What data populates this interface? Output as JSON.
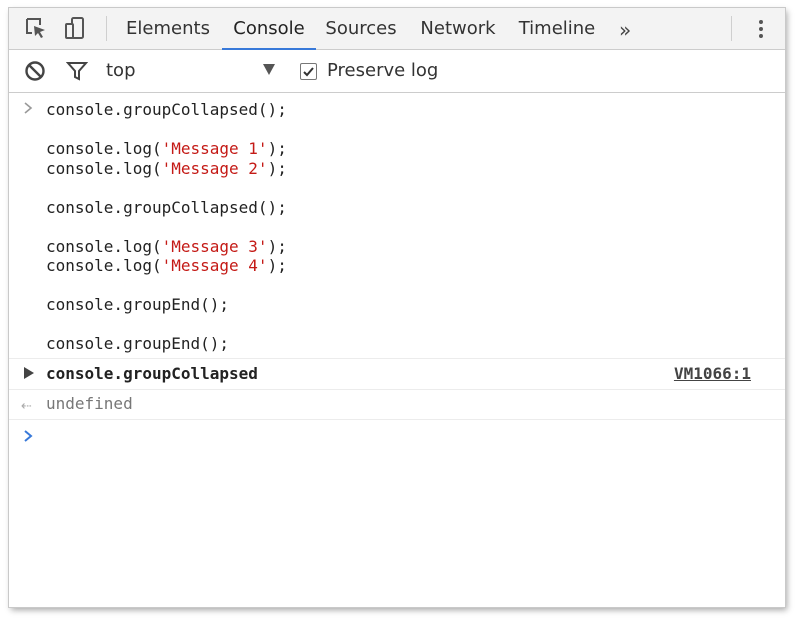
{
  "toolbar": {
    "tabs": [
      {
        "label": "Elements",
        "active": false
      },
      {
        "label": "Console",
        "active": true
      },
      {
        "label": "Sources",
        "active": false
      },
      {
        "label": "Network",
        "active": false
      },
      {
        "label": "Timeline",
        "active": false
      }
    ],
    "overflow_icon": "double-chevron-right-icon",
    "menu_icon": "vertical-ellipsis-icon"
  },
  "filterbar": {
    "context": "top",
    "preserve_log_label": "Preserve log",
    "preserve_log_checked": true
  },
  "console": {
    "input_command": {
      "lines": [
        [
          {
            "t": "console.groupCollapsed();",
            "s": false
          }
        ],
        [],
        [
          {
            "t": "console.log(",
            "s": false
          },
          {
            "t": "'Message 1'",
            "s": true
          },
          {
            "t": ");",
            "s": false
          }
        ],
        [
          {
            "t": "console.log(",
            "s": false
          },
          {
            "t": "'Message 2'",
            "s": true
          },
          {
            "t": ");",
            "s": false
          }
        ],
        [],
        [
          {
            "t": "console.groupCollapsed();",
            "s": false
          }
        ],
        [],
        [
          {
            "t": "console.log(",
            "s": false
          },
          {
            "t": "'Message 3'",
            "s": true
          },
          {
            "t": ");",
            "s": false
          }
        ],
        [
          {
            "t": "console.log(",
            "s": false
          },
          {
            "t": "'Message 4'",
            "s": true
          },
          {
            "t": ");",
            "s": false
          }
        ],
        [],
        [
          {
            "t": "console.groupEnd();",
            "s": false
          }
        ],
        [],
        [
          {
            "t": "console.groupEnd();",
            "s": false
          }
        ]
      ]
    },
    "group": {
      "title": "console.groupCollapsed",
      "source": "VM1066:1"
    },
    "result": "undefined",
    "colors": {
      "string": "#c41a16",
      "accent": "#3879d9"
    }
  }
}
